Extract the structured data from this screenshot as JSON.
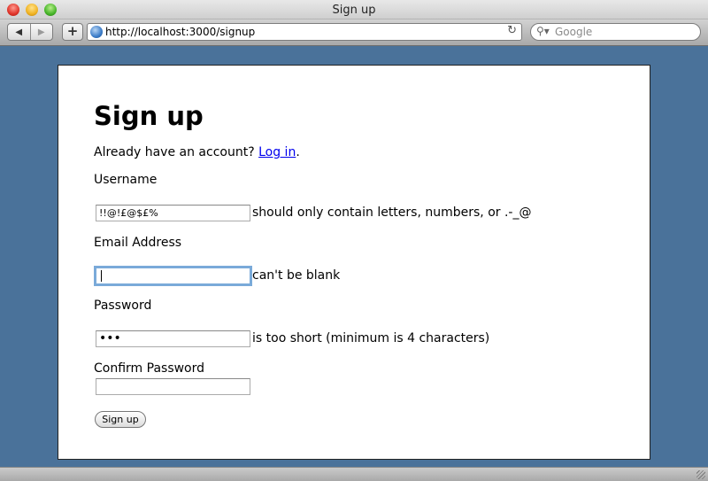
{
  "window": {
    "title": "Sign up"
  },
  "toolbar": {
    "url": "http://localhost:3000/signup",
    "search_placeholder": "Google",
    "back_icon": "◀",
    "forward_icon": "▶",
    "add_icon": "+",
    "reload_icon": "↻",
    "search_icon": "⚲▾"
  },
  "page": {
    "heading": "Sign up",
    "already_text": "Already have an account? ",
    "login_link": "Log in",
    "period": "."
  },
  "form": {
    "username": {
      "label": "Username",
      "value": "!!@!£@$£%",
      "error": "should only contain letters, numbers, or .-_@"
    },
    "email": {
      "label": "Email Address",
      "value": "",
      "error": "can't be blank"
    },
    "password": {
      "label": "Password",
      "value": "•••",
      "error": "is too short (minimum is 4 characters)"
    },
    "confirm": {
      "label": "Confirm Password",
      "value": ""
    },
    "submit_label": "Sign up"
  }
}
